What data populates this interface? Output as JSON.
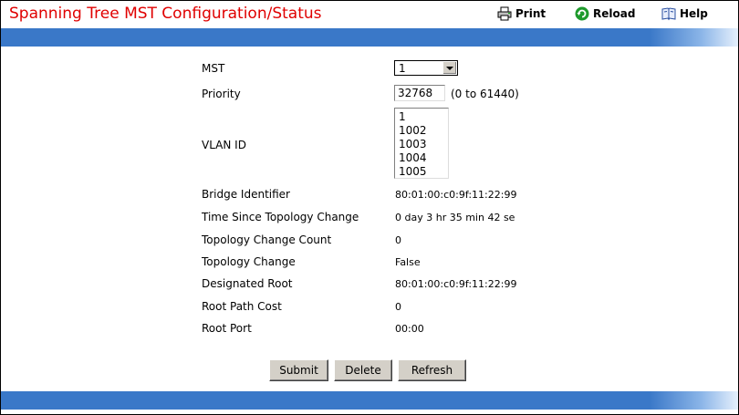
{
  "header": {
    "title": "Spanning Tree MST Configuration/Status",
    "print_label": "Print",
    "reload_label": "Reload",
    "help_label": "Help"
  },
  "form": {
    "mst": {
      "label": "MST",
      "value": "1"
    },
    "priority": {
      "label": "Priority",
      "value": "32768",
      "hint": "(0 to 61440)"
    },
    "vlan": {
      "label": "VLAN ID",
      "options": [
        "1",
        "1002",
        "1003",
        "1004",
        "1005"
      ]
    }
  },
  "status": {
    "bridge_identifier": {
      "label": "Bridge Identifier",
      "value": "80:01:00:c0:9f:11:22:99"
    },
    "time_since_topology_change": {
      "label": "Time Since Topology Change",
      "value": "0 day 3 hr 35 min 42 se"
    },
    "topology_change_count": {
      "label": "Topology Change Count",
      "value": "0"
    },
    "topology_change": {
      "label": "Topology Change",
      "value": "False"
    },
    "designated_root": {
      "label": "Designated Root",
      "value": "80:01:00:c0:9f:11:22:99"
    },
    "root_path_cost": {
      "label": "Root Path Cost",
      "value": "0"
    },
    "root_port": {
      "label": "Root Port",
      "value": "00:00"
    }
  },
  "buttons": {
    "submit": "Submit",
    "delete": "Delete",
    "refresh": "Refresh"
  },
  "colors": {
    "title": "#e00000",
    "band": "#3a78c8"
  },
  "icons": {
    "print": "printer-icon",
    "reload": "reload-icon",
    "help": "help-book-icon",
    "dropdown": "chevron-down-icon"
  }
}
